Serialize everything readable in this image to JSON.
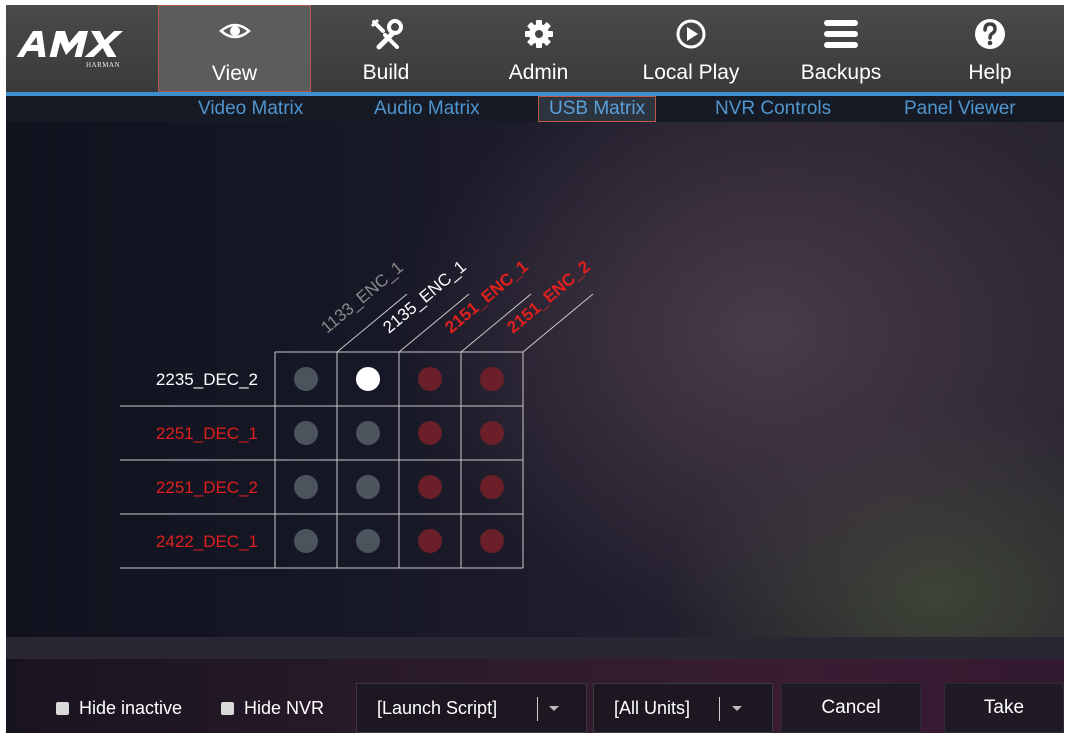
{
  "logo": {
    "brand": "AMX",
    "sub": "HARMAN"
  },
  "nav": {
    "tabs": [
      {
        "label": "View",
        "icon": "eye-icon"
      },
      {
        "label": "Build",
        "icon": "tools-icon"
      },
      {
        "label": "Admin",
        "icon": "gear-icon"
      },
      {
        "label": "Local Play",
        "icon": "play-circle-icon"
      },
      {
        "label": "Backups",
        "icon": "menu-bars-icon"
      },
      {
        "label": "Help",
        "icon": "question-icon"
      }
    ],
    "active": "View"
  },
  "subnav": {
    "tabs": [
      {
        "label": "Video Matrix"
      },
      {
        "label": "Audio Matrix"
      },
      {
        "label": "USB Matrix"
      },
      {
        "label": "NVR Controls"
      },
      {
        "label": "Panel Viewer"
      }
    ],
    "active": "USB Matrix"
  },
  "matrix": {
    "columns": [
      {
        "label": "1133_ENC_1",
        "status": "inactive"
      },
      {
        "label": "2135_ENC_1",
        "status": "online"
      },
      {
        "label": "2151_ENC_1",
        "status": "offline"
      },
      {
        "label": "2151_ENC_2",
        "status": "offline"
      }
    ],
    "rows": [
      {
        "label": "2235_DEC_2",
        "status": "online"
      },
      {
        "label": "2251_DEC_1",
        "status": "offline"
      },
      {
        "label": "2251_DEC_2",
        "status": "offline"
      },
      {
        "label": "2422_DEC_1",
        "status": "offline"
      }
    ],
    "connected": [
      [
        0,
        1
      ]
    ],
    "colors": {
      "online": "#ffffff",
      "offline": "#e0201c",
      "inactive": "#8a8a8a",
      "dot_idle": "#4b535c",
      "dot_offline": "#6b1f29",
      "dot_connected": "#ffffff",
      "grid": "#c9c9c9"
    }
  },
  "footer": {
    "hide_inactive": {
      "label": "Hide inactive",
      "checked": false
    },
    "hide_nvr": {
      "label": "Hide NVR",
      "checked": false
    },
    "launch_script": {
      "value": "[Launch Script]"
    },
    "units": {
      "value": "[All Units]"
    },
    "cancel_label": "Cancel",
    "take_label": "Take"
  },
  "colors": {
    "accent": "#3d8fd0",
    "subnav_text": "#4f95cf",
    "active_border": "#c0584b"
  }
}
